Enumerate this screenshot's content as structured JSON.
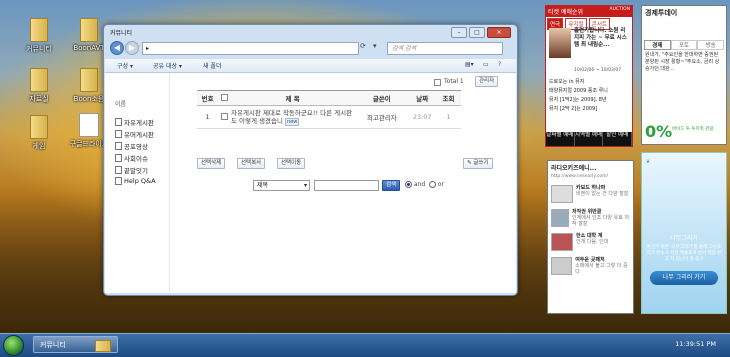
{
  "desktop": {
    "icons": [
      {
        "label": "커뮤니티"
      },
      {
        "label": "BoonAVT"
      },
      {
        "label": "자료실"
      },
      {
        "label": "Boon소음"
      },
      {
        "label": "게임"
      },
      {
        "label": "구글드라이브"
      }
    ]
  },
  "window": {
    "title": "커뮤니티",
    "address_text": "▸",
    "search_placeholder": "검색 검색",
    "toolbar": [
      "구성 ▾",
      "공유 대상 ▾",
      "새 폴더"
    ],
    "sidebar": {
      "heading": "이름",
      "items": [
        "자유게시판",
        "유머게시판",
        "공포영상",
        "사회이슈",
        "끝말잇기",
        "Help Q&A"
      ]
    },
    "total_label": "Total 1",
    "admin_label": "관리자",
    "columns": [
      "번호",
      "제 목",
      "글쓴이",
      "날짜",
      "조회"
    ],
    "rows": [
      {
        "num": "1",
        "title": "자유게시판 제대로 작동하군요!! 다른 게시판도 이렇게 생겼습니",
        "badge": "new",
        "author": "최고관리자",
        "date": "23:07",
        "views": "1"
      }
    ],
    "bulk_buttons": [
      "선택삭제",
      "선택복사",
      "선택이동"
    ],
    "write_button": "글쓰기",
    "search_field_select": "제목",
    "search_button": "검색",
    "radio_and": "and",
    "radio_or": "or"
  },
  "gadgets": {
    "ticket": {
      "header": "티켓 예매순위",
      "brand": "AUCTION",
      "tabs": [
        "연극",
        "뮤지컬",
        "콘서트"
      ],
      "headline": "홈런가합니다. 소원 리지피 가는 ~ 무료 시스템 최 내림순...",
      "date_range": "10/02/06 ~ 10/03/07",
      "list": [
        "드로오는 in 뮤지",
        "태양뮤지컬 2009 풍조 루니",
        "뮤지 [1막2]는 2009], 8년",
        "뮤지 [2막 2]는 2009]"
      ],
      "bottom": [
        "날짜별 예매",
        "지역별 예매",
        "할인 예매"
      ]
    },
    "news": {
      "title": "경제투데이",
      "tabs": [
        "경제",
        "포토",
        "방송"
      ],
      "body": "원내가, \"주요인을 한대하면 증권된 분양된 시장 활황~\"주요소, 금리 상승가던 대관...",
      "percent": "0%",
      "percent_note": "바이드 투 투저축 관광"
    },
    "radio": {
      "title": "라디오키즈에니...",
      "url": "http://www.nesearly.com/",
      "items": [
        {
          "title": "카보드 하나파",
          "desc": "비엔이 없는 건 다양 잘잘"
        },
        {
          "title": "저작권 위반클",
          "desc": "인계에서 인조 다양 유효 저작 잘잘"
        },
        {
          "title": "한소 대학 계",
          "desc": "인개 다음, 인대"
        },
        {
          "title": "여두운 곳패처",
          "desc": "소매에서 불고 그렇 더 중다"
        }
      ]
    },
    "tree": {
      "title": "나무그리기",
      "body": "환경부 위한 '나무그리기'를 통해 그린조리가 탄소가 저감 배출효과 받아 저장 판 고 자 당신이 많 중기",
      "button": "나무 그리러 가기"
    }
  },
  "taskbar": {
    "item": "커뮤니티",
    "clock": "11:39:51 PM"
  }
}
